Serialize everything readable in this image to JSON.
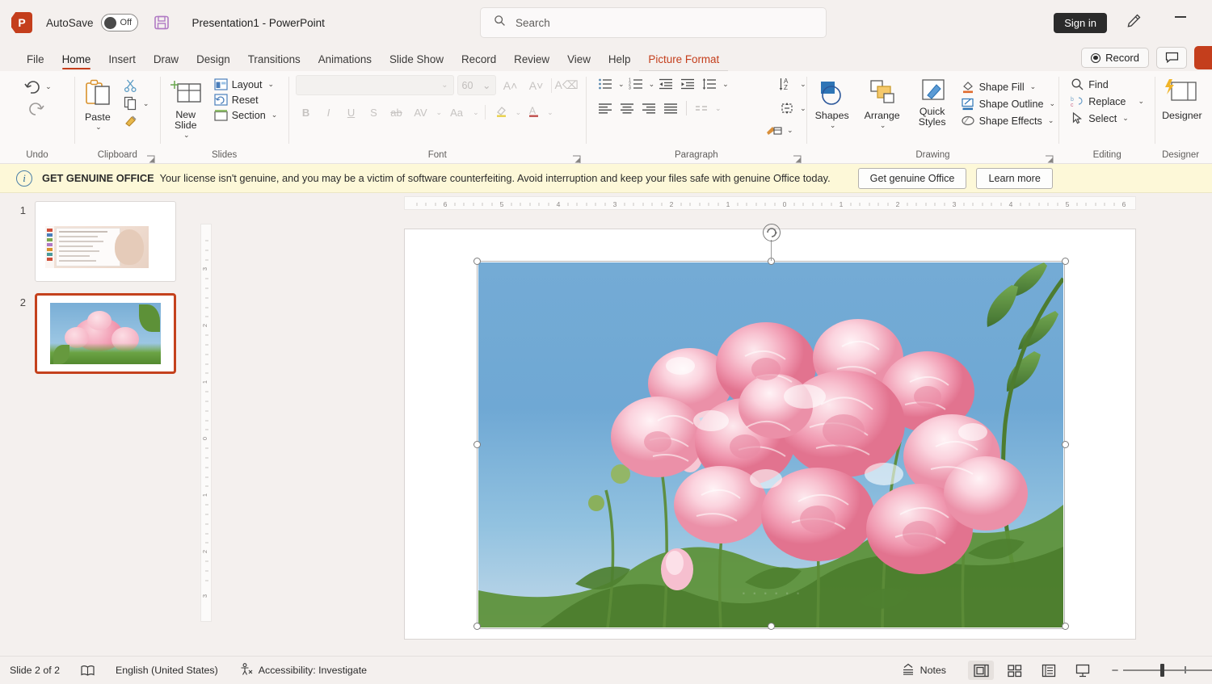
{
  "titlebar": {
    "app_icon": "powerpoint-logo-icon",
    "autosave_label": "AutoSave",
    "autosave_state": "Off",
    "save_icon": "save-disk-icon",
    "document_title": "Presentation1  -  PowerPoint",
    "search_placeholder": "Search",
    "search_icon": "search-icon",
    "signin_label": "Sign in",
    "pen_icon": "pen-highlight-icon",
    "minimize_icon": "minimize-icon"
  },
  "ribbon_tabs": {
    "items": [
      {
        "label": "File",
        "state": "normal"
      },
      {
        "label": "Home",
        "state": "active"
      },
      {
        "label": "Insert",
        "state": "normal"
      },
      {
        "label": "Draw",
        "state": "normal"
      },
      {
        "label": "Design",
        "state": "normal"
      },
      {
        "label": "Transitions",
        "state": "normal"
      },
      {
        "label": "Animations",
        "state": "normal"
      },
      {
        "label": "Slide Show",
        "state": "normal"
      },
      {
        "label": "Record",
        "state": "normal"
      },
      {
        "label": "Review",
        "state": "normal"
      },
      {
        "label": "View",
        "state": "normal"
      },
      {
        "label": "Help",
        "state": "normal"
      },
      {
        "label": "Picture Format",
        "state": "contextual"
      }
    ],
    "record_button": "Record",
    "comment_icon": "comment-icon",
    "share_icon": "share-button"
  },
  "ribbon": {
    "undo": {
      "group_label": "Undo",
      "undo_icon": "undo-arrow-icon",
      "redo_icon": "redo-arrow-icon"
    },
    "clipboard": {
      "group_label": "Clipboard",
      "paste_label": "Paste",
      "paste_icon": "paste-clipboard-icon",
      "cut_icon": "scissors-cut-icon",
      "copy_icon": "copy-icon",
      "format_painter_icon": "format-painter-brush-icon",
      "launcher_icon": "dialog-launcher-icon"
    },
    "slides": {
      "group_label": "Slides",
      "new_slide_label": "New Slide",
      "new_slide_icon": "new-slide-icon",
      "layout_label": "Layout",
      "layout_icon": "layout-icon",
      "reset_label": "Reset",
      "reset_icon": "reset-icon",
      "section_label": "Section",
      "section_icon": "section-icon"
    },
    "font": {
      "group_label": "Font",
      "font_name_value": "",
      "font_size_value": "60",
      "grow_font_icon": "grow-font-icon",
      "shrink_font_icon": "shrink-font-icon",
      "clear_formatting_icon": "clear-formatting-icon",
      "bold_label": "B",
      "italic_label": "I",
      "underline_label": "U",
      "shadow_label": "S",
      "strikethrough_label": "ab",
      "character_spacing_label": "AV",
      "change_case_label": "Aa",
      "text_highlight_icon": "text-highlight-color-icon",
      "font_color_icon": "font-color-icon",
      "launcher_icon": "dialog-launcher-icon",
      "disabled": true
    },
    "paragraph": {
      "group_label": "Paragraph",
      "bullets_icon": "bullet-list-icon",
      "numbering_icon": "numbered-list-icon",
      "decrease_indent_icon": "decrease-indent-icon",
      "increase_indent_icon": "increase-indent-icon",
      "line_spacing_icon": "line-spacing-icon",
      "align_left_icon": "align-left-icon",
      "align_center_icon": "align-center-icon",
      "align_right_icon": "align-right-icon",
      "justify_icon": "justify-icon",
      "columns_icon": "columns-icon",
      "text_direction_icon": "text-direction-icon",
      "align_text_icon": "align-text-icon",
      "convert_smartart_icon": "convert-to-smartart-icon",
      "launcher_icon": "dialog-launcher-icon"
    },
    "drawing": {
      "group_label": "Drawing",
      "shapes_label": "Shapes",
      "shapes_icon": "shapes-icon",
      "arrange_label": "Arrange",
      "arrange_icon": "arrange-icon",
      "quick_styles_label": "Quick Styles",
      "quick_styles_icon": "quick-styles-icon",
      "shape_fill_label": "Shape Fill",
      "shape_fill_icon": "shape-fill-icon",
      "shape_outline_label": "Shape Outline",
      "shape_outline_icon": "shape-outline-icon",
      "shape_effects_label": "Shape Effects",
      "shape_effects_icon": "shape-effects-icon",
      "launcher_icon": "dialog-launcher-icon"
    },
    "editing": {
      "group_label": "Editing",
      "find_label": "Find",
      "find_icon": "find-magnifier-icon",
      "replace_label": "Replace",
      "replace_icon": "replace-icon",
      "select_label": "Select",
      "select_icon": "select-cursor-icon"
    },
    "designer": {
      "group_label": "Designer",
      "designer_label": "Designer",
      "designer_icon": "designer-sparkle-icon"
    }
  },
  "notice": {
    "info_icon": "info-circle-icon",
    "headline": "GET GENUINE OFFICE",
    "message": "Your license isn't genuine, and you may be a victim of software counterfeiting. Avoid interruption and keep your files safe with genuine Office today.",
    "primary_button": "Get genuine Office",
    "secondary_button": "Learn more"
  },
  "thumbnails": {
    "slides": [
      {
        "number": "1",
        "selected": false
      },
      {
        "number": "2",
        "selected": true
      }
    ]
  },
  "rulers": {
    "horizontal_ticks": [
      "6",
      "5",
      "4",
      "3",
      "2",
      "1",
      "0",
      "1",
      "2",
      "3",
      "4",
      "5",
      "6"
    ],
    "vertical_ticks": [
      "3",
      "2",
      "1",
      "0",
      "1",
      "2",
      "3"
    ]
  },
  "canvas": {
    "selected_object": "picture-roses",
    "rotate_handle_icon": "rotate-handle-icon",
    "sky_color": "#6fa8d4",
    "rose_color": "#f2a0b4",
    "leaf_color": "#5b8b3a"
  },
  "status": {
    "slide_counter": "Slide 2 of 2",
    "notes_page_icon": "notes-page-icon",
    "language": "English (United States)",
    "spellcheck_icon": "spellcheck-icon",
    "accessibility_icon": "accessibility-icon",
    "accessibility": "Accessibility: Investigate",
    "notes_label": "Notes",
    "notes_icon": "notes-chevron-icon",
    "view_normal_icon": "normal-view-icon",
    "view_sorter_icon": "slide-sorter-icon",
    "view_reading_icon": "reading-view-icon",
    "view_slideshow_icon": "slideshow-view-icon",
    "zoom_out_icon": "zoom-out-icon",
    "zoom_in_icon": "zoom-in-icon",
    "fit_slide_icon": "fit-slide-to-window-icon"
  }
}
